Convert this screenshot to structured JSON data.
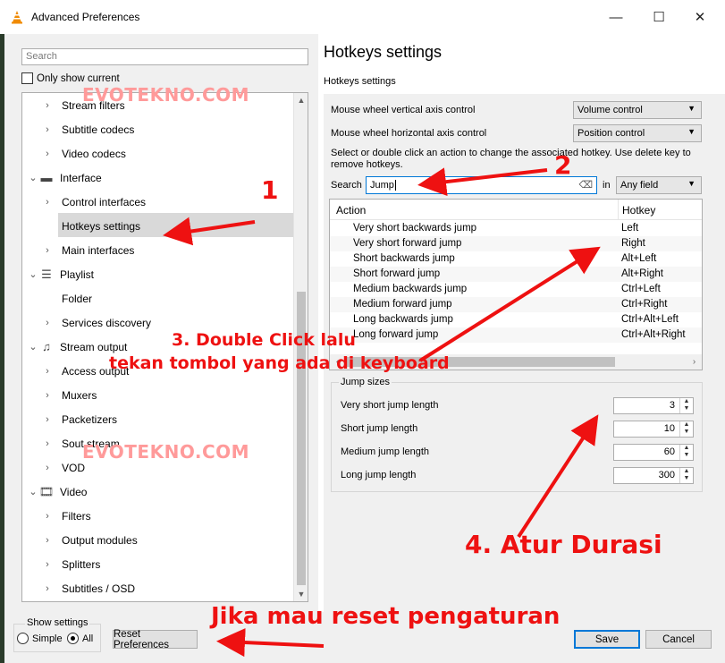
{
  "window": {
    "title": "Advanced Preferences",
    "minimize_glyph": "—",
    "maximize_glyph": "☐",
    "close_glyph": "✕",
    "app_icon": "vlc-cone-icon"
  },
  "left": {
    "search_placeholder": "Search",
    "only_show_current": "Only show current",
    "tree": [
      {
        "label": "Stream filters",
        "indent": 2,
        "icon": null,
        "chevron": "›",
        "selected": false
      },
      {
        "label": "Subtitle codecs",
        "indent": 2,
        "icon": null,
        "chevron": "›",
        "selected": false
      },
      {
        "label": "Video codecs",
        "indent": 2,
        "icon": null,
        "chevron": "›",
        "selected": false
      },
      {
        "label": "Interface",
        "indent": 1,
        "icon": "paint-roller-icon",
        "chevron": "⌄",
        "selected": false
      },
      {
        "label": "Control interfaces",
        "indent": 2,
        "icon": null,
        "chevron": "›",
        "selected": false
      },
      {
        "label": "Hotkeys settings",
        "indent": 2,
        "icon": null,
        "chevron": "",
        "selected": true
      },
      {
        "label": "Main interfaces",
        "indent": 2,
        "icon": null,
        "chevron": "›",
        "selected": false
      },
      {
        "label": "Playlist",
        "indent": 1,
        "icon": "playlist-icon",
        "chevron": "⌄",
        "selected": false
      },
      {
        "label": "Folder",
        "indent": 2,
        "icon": null,
        "chevron": "",
        "selected": false
      },
      {
        "label": "Services discovery",
        "indent": 2,
        "icon": null,
        "chevron": "›",
        "selected": false
      },
      {
        "label": "Stream output",
        "indent": 1,
        "icon": "stream-output-icon",
        "chevron": "⌄",
        "selected": false
      },
      {
        "label": "Access output",
        "indent": 2,
        "icon": null,
        "chevron": "›",
        "selected": false
      },
      {
        "label": "Muxers",
        "indent": 2,
        "icon": null,
        "chevron": "›",
        "selected": false
      },
      {
        "label": "Packetizers",
        "indent": 2,
        "icon": null,
        "chevron": "›",
        "selected": false
      },
      {
        "label": "Sout stream",
        "indent": 2,
        "icon": null,
        "chevron": "›",
        "selected": false
      },
      {
        "label": "VOD",
        "indent": 2,
        "icon": null,
        "chevron": "›",
        "selected": false
      },
      {
        "label": "Video",
        "indent": 1,
        "icon": "video-icon",
        "chevron": "⌄",
        "selected": false
      },
      {
        "label": "Filters",
        "indent": 2,
        "icon": null,
        "chevron": "›",
        "selected": false
      },
      {
        "label": "Output modules",
        "indent": 2,
        "icon": null,
        "chevron": "›",
        "selected": false
      },
      {
        "label": "Splitters",
        "indent": 2,
        "icon": null,
        "chevron": "›",
        "selected": false
      },
      {
        "label": "Subtitles / OSD",
        "indent": 2,
        "icon": null,
        "chevron": "›",
        "selected": false
      }
    ],
    "show_settings": {
      "legend": "Show settings",
      "simple": "Simple",
      "all": "All",
      "selected": "All"
    },
    "reset_button": "Reset Preferences"
  },
  "right": {
    "title": "Hotkeys settings",
    "subtitle": "Hotkeys settings",
    "mouse_vertical_label": "Mouse wheel vertical axis control",
    "mouse_vertical_value": "Volume control",
    "mouse_horizontal_label": "Mouse wheel horizontal axis control",
    "mouse_horizontal_value": "Position control",
    "instruction": "Select or double click an action to change the associated hotkey. Use delete key to remove hotkeys.",
    "search_label": "Search",
    "search_value": "Jump",
    "in_label": "in",
    "field_value": "Any field",
    "table": {
      "col_action": "Action",
      "col_hotkey": "Hotkey",
      "rows": [
        {
          "action": "Very short backwards jump",
          "hotkey": "Left"
        },
        {
          "action": "Very short forward jump",
          "hotkey": "Right"
        },
        {
          "action": "Short backwards jump",
          "hotkey": "Alt+Left"
        },
        {
          "action": "Short forward jump",
          "hotkey": "Alt+Right"
        },
        {
          "action": "Medium backwards jump",
          "hotkey": "Ctrl+Left"
        },
        {
          "action": "Medium forward jump",
          "hotkey": "Ctrl+Right"
        },
        {
          "action": "Long backwards jump",
          "hotkey": "Ctrl+Alt+Left"
        },
        {
          "action": "Long forward jump",
          "hotkey": "Ctrl+Alt+Right"
        }
      ]
    },
    "jump_sizes": {
      "legend": "Jump sizes",
      "items": [
        {
          "label": "Very short jump length",
          "value": "3"
        },
        {
          "label": "Short jump length",
          "value": "10"
        },
        {
          "label": "Medium jump length",
          "value": "60"
        },
        {
          "label": "Long jump length",
          "value": "300"
        }
      ]
    },
    "save_button": "Save",
    "cancel_button": "Cancel"
  },
  "annotations": {
    "watermark": "EVOTEKNO.COM",
    "step1": "1",
    "step2": "2",
    "step3_line1": "3. Double Click lalu",
    "step3_line2": "tekan tombol yang ada di keyboard",
    "step4": "4. Atur Durasi",
    "reset_note": "Jika mau reset pengaturan",
    "color": "#ee1111"
  }
}
